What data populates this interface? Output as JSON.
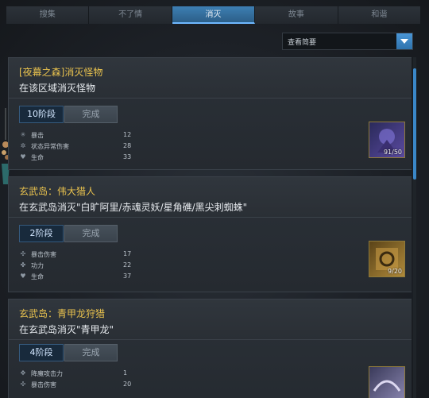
{
  "tabs": [
    "搜集",
    "不了情",
    "消灭",
    "故事",
    "和谐"
  ],
  "active_tab": "消灭",
  "filter": {
    "value": "查看简要",
    "icon": "chevron-down-icon"
  },
  "quests": [
    {
      "title": "[夜幕之森]消灭怪物",
      "desc": "在该区域消灭怪物",
      "stage": "10阶段",
      "complete": "完成",
      "stats": [
        {
          "icon": "crit-icon",
          "name": "暴击",
          "value": "12"
        },
        {
          "icon": "status-damage-icon",
          "name": "状态异常伤害",
          "value": "28"
        },
        {
          "icon": "heart-icon",
          "name": "生命",
          "value": "33"
        }
      ],
      "reward": {
        "icon": "monster-reward-icon",
        "count": "91/50",
        "color": "#3f3a78"
      }
    },
    {
      "title": "玄武岛：伟大猎人",
      "desc": "在玄武岛消灭\"白旷阿里/赤魂灵妖/星角礁/黑尖刺蜘蛛\"",
      "stage": "2阶段",
      "complete": "完成",
      "stats": [
        {
          "icon": "crit-damage-icon",
          "name": "暴击伤害",
          "value": "17"
        },
        {
          "icon": "power-icon",
          "name": "功力",
          "value": "22"
        },
        {
          "icon": "heart-icon",
          "name": "生命",
          "value": "37"
        }
      ],
      "reward": {
        "icon": "scroll-reward-icon",
        "count": "9/20",
        "color": "#8a6a28"
      }
    },
    {
      "title": "玄武岛：青甲龙狩猎",
      "desc": "在玄武岛消灭\"青甲龙\"",
      "stage": "4阶段",
      "complete": "完成",
      "stats": [
        {
          "icon": "demon-attack-icon",
          "name": "降魔攻击力",
          "value": "1"
        },
        {
          "icon": "crit-damage-icon",
          "name": "暴击伤害",
          "value": "20"
        }
      ],
      "reward": {
        "icon": "dragon-reward-icon",
        "count": "",
        "color": "#6d6a8a"
      }
    }
  ]
}
